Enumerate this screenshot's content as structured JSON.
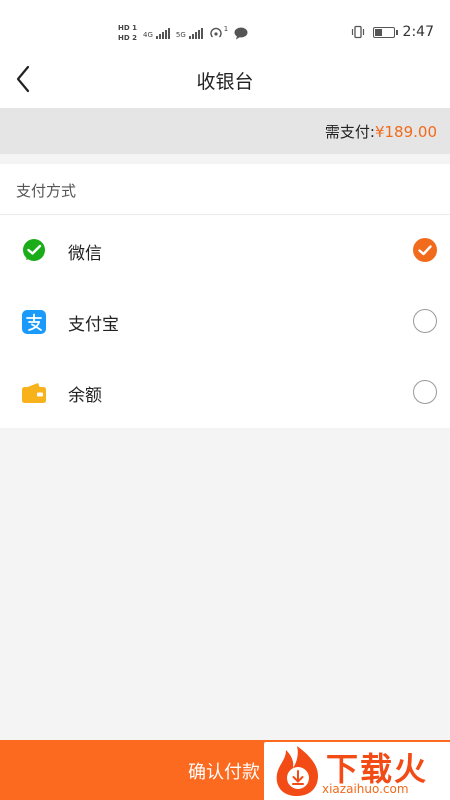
{
  "status_bar": {
    "hd1": "HD 1",
    "hd2": "HD 2",
    "net1": "4G",
    "net2": "5G",
    "hotspot_count": "1",
    "time": "2:47",
    "battery_level": 0.45
  },
  "nav": {
    "title": "收银台"
  },
  "amount": {
    "label": "需支付:",
    "value": "¥189.00"
  },
  "payment": {
    "section_title": "支付方式",
    "methods": [
      {
        "label": "微信",
        "icon": "wechat-icon",
        "color": "#1aad19",
        "selected": true
      },
      {
        "label": "支付宝",
        "icon": "alipay-icon",
        "color": "#1a9bfc",
        "selected": false
      },
      {
        "label": "余额",
        "icon": "wallet-icon",
        "color": "#f8b21b",
        "selected": false
      }
    ]
  },
  "footer": {
    "confirm_label": "确认付款"
  },
  "watermark": {
    "text": "下载火",
    "sub": "xiazaihuo.com"
  },
  "colors": {
    "accent": "#f26a1b",
    "confirm_bg": "#fb6a1f"
  }
}
